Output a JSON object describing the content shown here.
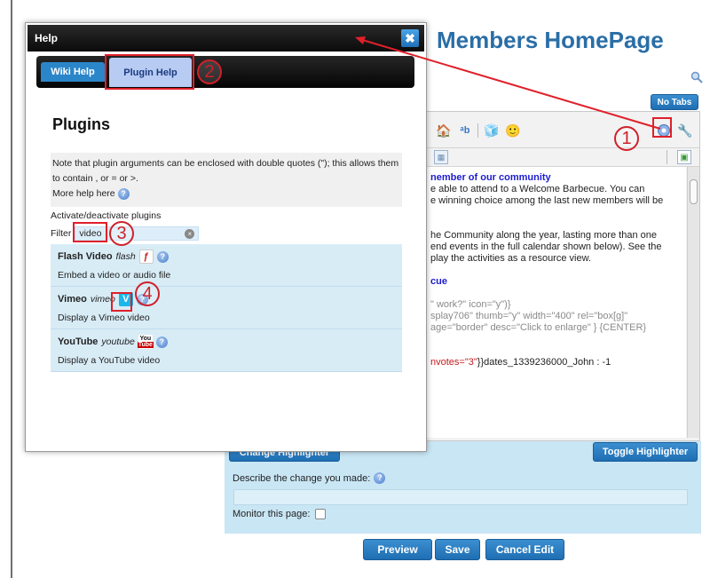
{
  "page": {
    "title": "Members HomePage",
    "no_tabs_label": "No Tabs"
  },
  "editor": {
    "lines": [
      {
        "text": "nember of our community",
        "style": "blue-bold"
      },
      {
        "text": "e able to attend to a Welcome Barbecue. You can",
        "style": ""
      },
      {
        "text": "e winning choice among the last new members will be",
        "style": ""
      },
      {
        "text": "",
        "style": ""
      },
      {
        "text": "",
        "style": ""
      },
      {
        "text": "he Community along the year, lasting more than one",
        "style": ""
      },
      {
        "text": "end events in the full calendar shown below). See the",
        "style": ""
      },
      {
        "text": "play the activities as a resource view.",
        "style": ""
      },
      {
        "text": "",
        "style": ""
      },
      {
        "text": "cue",
        "style": "blue-bold"
      },
      {
        "text": "",
        "style": ""
      },
      {
        "text": "\" work?\" icon=\"y\")}",
        "style": "gray"
      },
      {
        "text": "splay706\" thumb=\"y\" width=\"400\" rel=\"box[g]\"",
        "style": "gray"
      },
      {
        "text": "age=\"border\" desc=\"Click to enlarge\" } {CENTER}",
        "style": "gray"
      },
      {
        "text": "",
        "style": ""
      },
      {
        "text": "",
        "style": ""
      }
    ],
    "votes_prefix": "nvotes=",
    "votes_value": "\"3\"",
    "votes_suffix": "}}dates_1339236000_John : -1"
  },
  "bottom": {
    "change_highlighter": "Change Highlighter",
    "toggle_highlighter": "Toggle Highlighter",
    "describe_label": "Describe the change you made:",
    "describe_value": "",
    "monitor_label": "Monitor this page:",
    "preview": "Preview",
    "save": "Save",
    "cancel": "Cancel Edit"
  },
  "help": {
    "title": "Help",
    "close": "✖",
    "tabs": [
      "Wiki Help",
      "Plugin Help"
    ],
    "active_tab": "Plugin Help",
    "heading": "Plugins",
    "note_line1": "Note that plugin arguments can be enclosed with double quotes (\"); this allows them",
    "note_line2": "to contain , or = or >.",
    "more_help": "More help here",
    "activate_label": "Activate/deactivate plugins",
    "filter_label": "Filter",
    "filter_value": "video",
    "plugins": [
      {
        "name": "Flash Video",
        "code": "flash",
        "icon": "flash-icon",
        "desc": "Embed a video or audio file"
      },
      {
        "name": "Vimeo",
        "code": "vimeo",
        "icon": "vimeo-icon",
        "desc": "Display a Vimeo video"
      },
      {
        "name": "YouTube",
        "code": "youtube",
        "icon": "youtube-icon",
        "desc": "Display a YouTube video"
      }
    ]
  },
  "annotations": [
    "1",
    "2",
    "3",
    "4"
  ],
  "colors": {
    "accent_blue": "#2a6ea6",
    "button_blue": "#1f6eb3",
    "annotation_red": "#d0202a",
    "panel_blue": "#c9e6f5"
  }
}
